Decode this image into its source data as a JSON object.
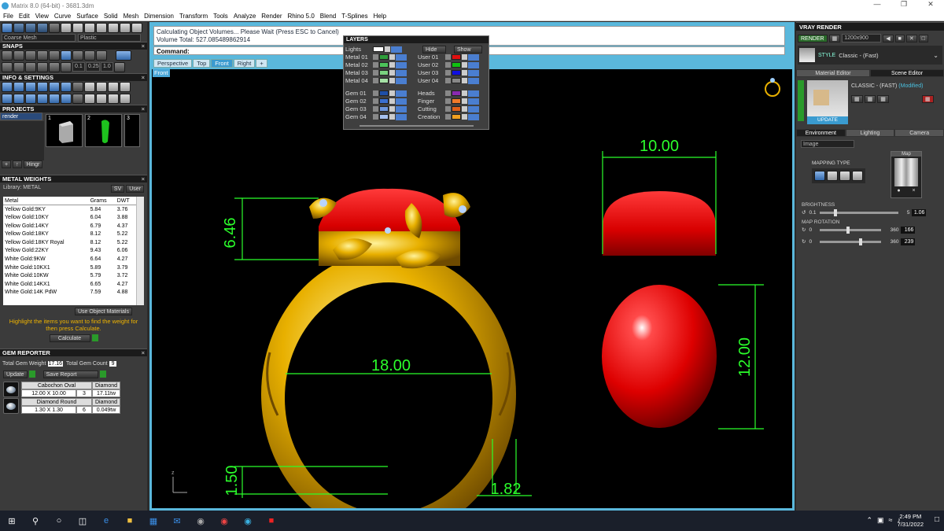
{
  "window": {
    "title": "Matrix 8.0 (64-bit) - 3681.3dm"
  },
  "menu": [
    "File",
    "Edit",
    "View",
    "Curve",
    "Surface",
    "Solid",
    "Mesh",
    "Dimension",
    "Transform",
    "Tools",
    "Analyze",
    "Render",
    "Rhino 5.0",
    "Blend",
    "T-Splines",
    "Help"
  ],
  "left": {
    "mesh_select": "Coarse Mesh",
    "material_select": "Plastic",
    "snaps_title": "SNAPS",
    "snap_values": [
      "0.1",
      "0.25",
      "1.0"
    ],
    "info_title": "INFO & SETTINGS",
    "projects_title": "PROJECTS",
    "project_select": "render",
    "project_numbers": [
      "1",
      "2",
      "3"
    ],
    "project_buttons": {
      "hinge": "Hingr"
    },
    "metal_title": "METAL WEIGHTS",
    "library_label": "Library: METAL",
    "library_buttons": [
      "SV",
      "User"
    ],
    "metal_headers": [
      "Metal",
      "Grams",
      "DWT"
    ],
    "metals": [
      [
        "Yellow Gold:9KY",
        "5.84",
        "3.76"
      ],
      [
        "Yellow Gold:10KY",
        "6.04",
        "3.88"
      ],
      [
        "Yellow Gold:14KY",
        "6.79",
        "4.37"
      ],
      [
        "Yellow Gold:18KY",
        "8.12",
        "5.22"
      ],
      [
        "Yellow Gold:18KY Royal",
        "8.12",
        "5.22"
      ],
      [
        "Yellow Gold:22KY",
        "9.43",
        "6.06"
      ],
      [
        "White Gold:9KW",
        "6.64",
        "4.27"
      ],
      [
        "White Gold:10KX1",
        "5.89",
        "3.79"
      ],
      [
        "White Gold:10KW",
        "5.79",
        "3.72"
      ],
      [
        "White Gold:14KX1",
        "6.65",
        "4.27"
      ],
      [
        "White Gold:14K PdW",
        "7.59",
        "4.88"
      ]
    ],
    "use_materials": "Use Object Materials",
    "hint": "Highlight the items you want to find the weight for then press Calculate.",
    "calculate": "Calculate",
    "gem_title": "GEM REPORTER",
    "total_weight_label": "Total Gem Weight",
    "total_weight": "17.16",
    "total_count_label": "Total Gem Count",
    "total_count": "9",
    "update": "Update",
    "save_report": "Save Report",
    "gems": [
      {
        "shape": "Cabochon Oval",
        "type": "Diamond",
        "size": "12.00 X 10.00",
        "count": "3",
        "weight": "17.11tw"
      },
      {
        "shape": "Diamond Round",
        "type": "Diamond",
        "size": "1.30 X 1.30",
        "count": "6",
        "weight": "0.049tw"
      }
    ]
  },
  "main": {
    "status_line1": "Calculating Object Volumes... Please Wait (Press ESC to Cancel)",
    "status_line2": "Volume Total: 527.085489862914",
    "command_label": "Command:",
    "tabs": [
      "Perspective",
      "Top",
      "Front",
      "Right"
    ],
    "active_tab": "Front",
    "viewport_label": "Front",
    "dimensions": {
      "height_ring": "6.46",
      "width_top": "10.00",
      "ring_inner": "18.00",
      "gem_height": "12.00",
      "band_thick": "1.50",
      "band_width": "1.82"
    },
    "axis": "z"
  },
  "layers": {
    "title": "LAYERS",
    "lights": "Lights",
    "hide": "Hide",
    "show": "Show",
    "left": [
      {
        "name": "Metal 01",
        "color": "#2e9e3a"
      },
      {
        "name": "Metal 02",
        "color": "#4cc35a"
      },
      {
        "name": "Metal 03",
        "color": "#7ad27f"
      },
      {
        "name": "Metal 04",
        "color": "#a4e0a4"
      },
      {
        "name": "Gem 01",
        "color": "#1e4fa8"
      },
      {
        "name": "Gem 02",
        "color": "#3a6fd0"
      },
      {
        "name": "Gem 03",
        "color": "#6d97de"
      },
      {
        "name": "Gem 04",
        "color": "#a5c0ee"
      }
    ],
    "right": [
      {
        "name": "User 01",
        "color": "#e01010"
      },
      {
        "name": "User 02",
        "color": "#10c010"
      },
      {
        "name": "User 03",
        "color": "#1010e0"
      },
      {
        "name": "User 04",
        "color": "#888888"
      },
      {
        "name": "Heads",
        "color": "#8a2ab0"
      },
      {
        "name": "Finger",
        "color": "#f07a2a"
      },
      {
        "name": "Cutting",
        "color": "#e0601a"
      },
      {
        "name": "Creation",
        "color": "#f0a020"
      }
    ]
  },
  "right": {
    "title": "VRAY RENDER",
    "render": "RENDER",
    "resolution": "1200x900",
    "style_label": "STYLE",
    "style_value": "Classic - (Fast)",
    "tabs": [
      "Material Editor",
      "Scene Editor"
    ],
    "preset": "CLASSIC - (FAST)",
    "modified": "(Modified)",
    "update": "UPDATE",
    "env_tabs": [
      "Environment",
      "Lighting",
      "Camera"
    ],
    "image_select": "Image",
    "mapping_type": "MAPPING TYPE",
    "map": "Map",
    "brightness": "BRIGHTNESS",
    "b_min": "0.1",
    "b_max": "5",
    "b_val": "1.06",
    "map_rotation": "MAP ROTATION",
    "r1_min": "0",
    "r1_max": "360",
    "r1_val": "166",
    "r2_min": "0",
    "r2_max": "360",
    "r2_val": "239"
  },
  "taskbar": {
    "time": "2:49 PM",
    "date": "7/31/2022"
  },
  "colors": {
    "accent": "#5ab8dc",
    "dimension": "#2bff2b",
    "gold": "#e8b000",
    "gem": "#e00000"
  }
}
